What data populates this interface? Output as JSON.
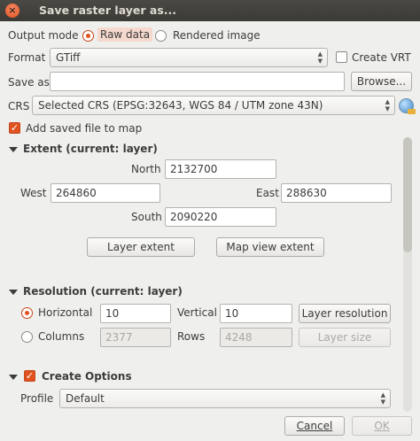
{
  "window": {
    "title": "Save raster layer as..."
  },
  "output_mode": {
    "label": "Output mode",
    "raw": "Raw data",
    "rendered": "Rendered image",
    "selected": "raw"
  },
  "format": {
    "label": "Format",
    "value": "GTiff",
    "create_vrt": "Create VRT"
  },
  "save_as": {
    "label": "Save as",
    "value": "",
    "browse": "Browse..."
  },
  "crs": {
    "label": "CRS",
    "value": "Selected CRS (EPSG:32643, WGS 84 / UTM zone 43N)"
  },
  "add_to_map": {
    "label": "Add saved file to map",
    "checked": true
  },
  "extent": {
    "title": "Extent (current: layer)",
    "north_label": "North",
    "north": "2132700",
    "west_label": "West",
    "west": "264860",
    "east_label": "East",
    "east": "288630",
    "south_label": "South",
    "south": "2090220",
    "layer_extent": "Layer extent",
    "map_view_extent": "Map view extent"
  },
  "resolution": {
    "title": "Resolution (current: layer)",
    "horizontal_label": "Horizontal",
    "horizontal": "10",
    "vertical_label": "Vertical",
    "vertical": "10",
    "layer_resolution": "Layer resolution",
    "columns_label": "Columns",
    "columns": "2377",
    "rows_label": "Rows",
    "rows": "4248",
    "layer_size": "Layer size",
    "selected": "horizontal"
  },
  "create_options": {
    "title": "Create Options",
    "profile_label": "Profile",
    "profile": "Default"
  },
  "footer": {
    "cancel": "Cancel",
    "ok": "OK"
  }
}
